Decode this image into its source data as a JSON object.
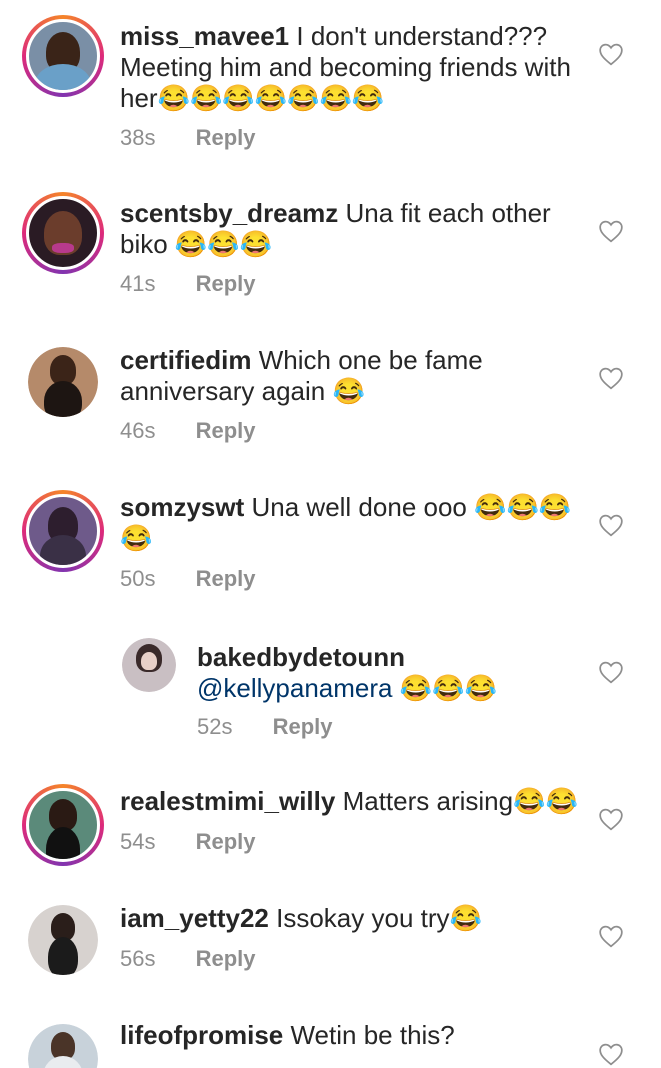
{
  "comments": [
    {
      "username": "miss_mavee1",
      "text": "I don't understand??? Meeting him and becoming friends with her😂😂😂😂😂😂😂",
      "line1": "I don't understand???",
      "line2": "Meeting him and becoming friends with",
      "line3": "her😂😂😂😂😂😂😂",
      "time": "38s",
      "reply": "Reply",
      "avatar_ring": true
    },
    {
      "username": "scentsby_dreamz",
      "line1": "Una fit each other",
      "line2": "biko 😂😂😂",
      "time": "41s",
      "reply": "Reply",
      "avatar_ring": true
    },
    {
      "username": "certifiedim",
      "line1": "Which one be fame",
      "line2": "anniversary again 😂",
      "time": "46s",
      "reply": "Reply",
      "avatar_ring": false
    },
    {
      "username": "somzyswt",
      "line1": "Una well done ooo 😂😂😂",
      "line2": "😂",
      "time": "50s",
      "reply": "Reply",
      "avatar_ring": true
    },
    {
      "username": "bakedbydetounn",
      "mention": "@kellypanamera",
      "line2": " 😂😂😂",
      "time": "52s",
      "reply": "Reply",
      "avatar_ring": false,
      "is_reply": true
    },
    {
      "username": "realestmimi_willy",
      "line1": "Matters arising😂😂",
      "time": "54s",
      "reply": "Reply",
      "avatar_ring": true
    },
    {
      "username": "iam_yetty22",
      "line1": "Issokay you try😂",
      "time": "56s",
      "reply": "Reply",
      "avatar_ring": false
    },
    {
      "username": "lifeofpromise",
      "line1": "Wetin be this?",
      "avatar_ring": false
    }
  ],
  "colors": {
    "text": "#262626",
    "meta": "#8e8e8e",
    "mention": "#003569",
    "ring_start": "#f58529",
    "ring_end": "#8134af"
  },
  "icons": {
    "like": "heart-outline-icon"
  }
}
